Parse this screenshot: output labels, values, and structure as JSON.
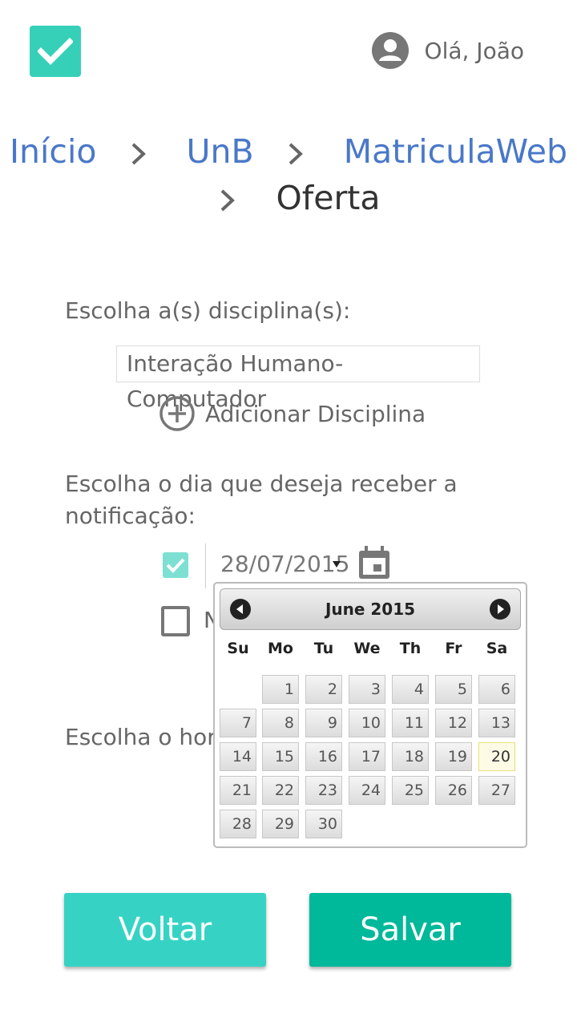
{
  "header": {
    "greeting": "Olá, João"
  },
  "breadcrumb": {
    "items": [
      "Início",
      "UnB",
      "MatriculaWeb"
    ],
    "current": "Oferta"
  },
  "form": {
    "disciplines_label": "Escolha a(s) disciplina(s):",
    "discipline_value": "Interação Humano-Computador",
    "add_discipline_label": "Adicionar Disciplina",
    "day_label_line1": "Escolha o dia que deseja receber a",
    "day_label_line2": "notificação:",
    "date_value": "28/07/2015",
    "option2_partial": "N",
    "time_label_partial": "Escolha o hor"
  },
  "datepicker": {
    "title": "June 2015",
    "weekdays": [
      "Su",
      "Mo",
      "Tu",
      "We",
      "Th",
      "Fr",
      "Sa"
    ],
    "days": [
      "1",
      "2",
      "3",
      "4",
      "5",
      "6",
      "7",
      "8",
      "9",
      "10",
      "11",
      "12",
      "13",
      "14",
      "15",
      "16",
      "17",
      "18",
      "19",
      "20",
      "21",
      "22",
      "23",
      "24",
      "25",
      "26",
      "27",
      "28",
      "29",
      "30"
    ],
    "today": "20"
  },
  "buttons": {
    "back": "Voltar",
    "save": "Salvar"
  },
  "colors": {
    "accent": "#36d0b9",
    "save": "#00b89a",
    "link": "#4a78c8"
  }
}
